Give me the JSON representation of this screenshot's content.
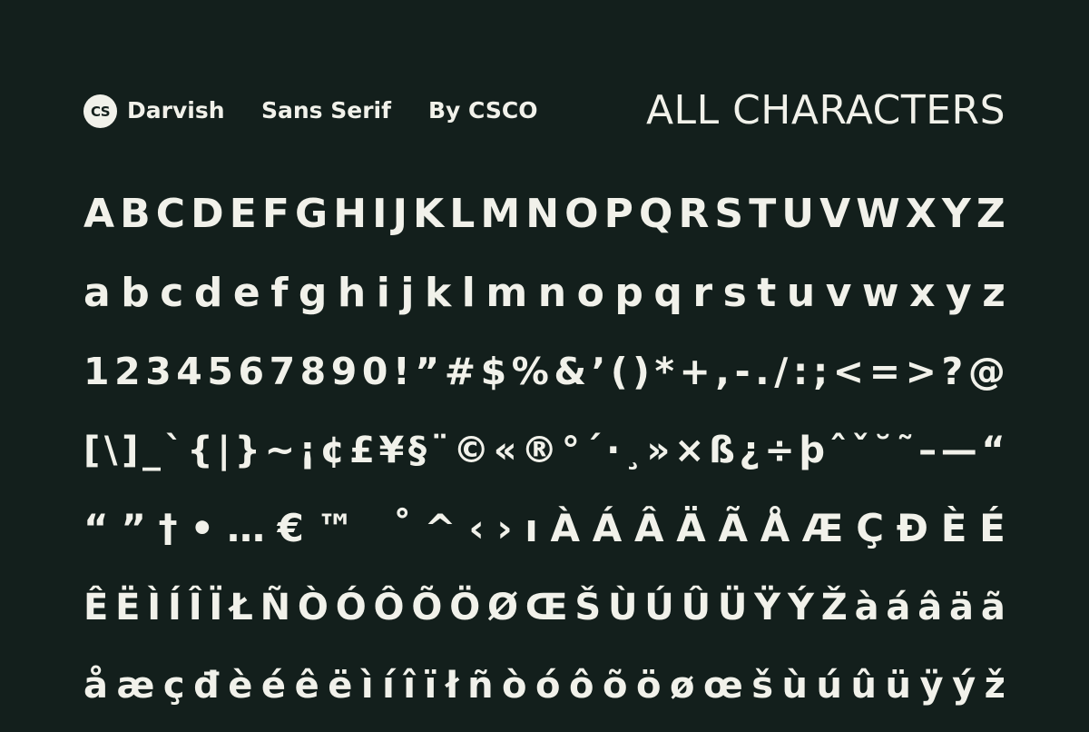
{
  "header": {
    "logo_text": "CS",
    "font_name": "Darvish",
    "style": "Sans Serif",
    "designer": "By CSCO",
    "title": "ALL CHARACTERS"
  },
  "rows": [
    {
      "id": "upper",
      "text": "ABCDEFGHIJKLMNOPQRSTUVWXYZ"
    },
    {
      "id": "lower",
      "text": "abcdefghijklmnopqrstuvwxyz"
    },
    {
      "id": "digits",
      "text": "1234567890!”#$%&’()*+,-./:;<=>?@"
    },
    {
      "id": "symbols-a",
      "text": "[\\]_`{|}~¡¢£¥§¨©«®°´·¸»×ß¿÷þˆˇ˘˜–—“"
    },
    {
      "id": "symbols-b",
      "text": "“”†•…€™ ˚^‹›ıÀÁÂÄÃÅÆÇĐÈÉ"
    },
    {
      "id": "accents-a",
      "text": "ÊËÌÍÎÏŁÑÒÓÔÕÖØŒŠÙÚÛÜŸÝŽàáâäã"
    },
    {
      "id": "accents-b",
      "text": "åæçđèéêëìíîïłñòóôõöøœšùúûüÿýž"
    }
  ],
  "colors": {
    "background": "#131f1c",
    "foreground": "#f1f1ea"
  }
}
